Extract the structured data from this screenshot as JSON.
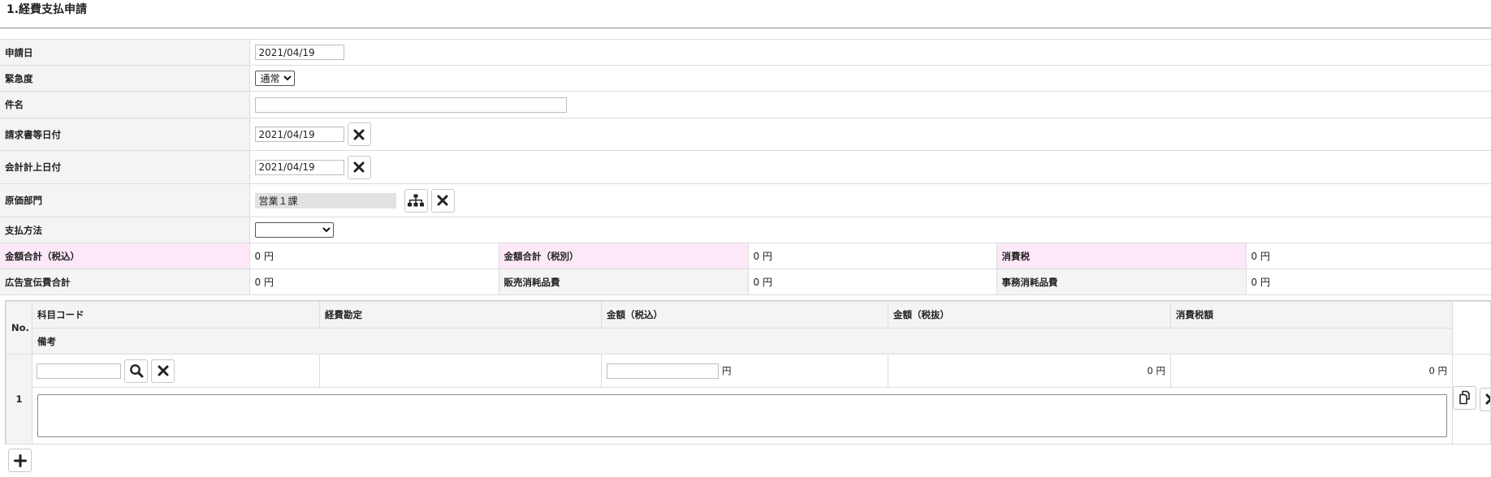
{
  "section": {
    "title": "1.経費支払申請"
  },
  "form": {
    "application_date": {
      "label": "申請日",
      "value": "2021/04/19"
    },
    "urgency": {
      "label": "緊急度",
      "value": "通常"
    },
    "subject": {
      "label": "件名",
      "value": ""
    },
    "invoice_date": {
      "label": "請求書等日付",
      "value": "2021/04/19"
    },
    "accounting_date": {
      "label": "会計計上日付",
      "value": "2021/04/19"
    },
    "cost_department": {
      "label": "原価部門",
      "value": "営業１課"
    },
    "payment_method": {
      "label": "支払方法",
      "value": ""
    },
    "totals": {
      "total_incl_tax": {
        "label": "金額合計（税込）",
        "value": "0 円"
      },
      "total_excl_tax": {
        "label": "金額合計（税別）",
        "value": "0 円"
      },
      "consumption_tax": {
        "label": "消費税",
        "value": "0 円"
      },
      "advertising_total": {
        "label": "広告宣伝費合計",
        "value": "0 円"
      },
      "sales_supplies": {
        "label": "販売消耗品費",
        "value": "0 円"
      },
      "office_supplies": {
        "label": "事務消耗品費",
        "value": "0 円"
      }
    }
  },
  "detail": {
    "headers": {
      "no": "No.",
      "account_code": "科目コード",
      "expense_account": "経費勘定",
      "amount_incl": "金額（税込）",
      "amount_excl": "金額（税抜）",
      "tax_amount": "消費税額",
      "remarks": "備考"
    },
    "rows": [
      {
        "no": "1",
        "account_code": "",
        "expense_account": "",
        "amount_incl": "",
        "amount_unit": "円",
        "amount_excl": "0 円",
        "tax_amount": "0 円",
        "remarks": ""
      }
    ]
  },
  "icons": {
    "delete": "close-icon",
    "org_tree": "org-tree-icon",
    "search": "search-icon",
    "copy": "copy-icon",
    "add": "plus-icon"
  }
}
